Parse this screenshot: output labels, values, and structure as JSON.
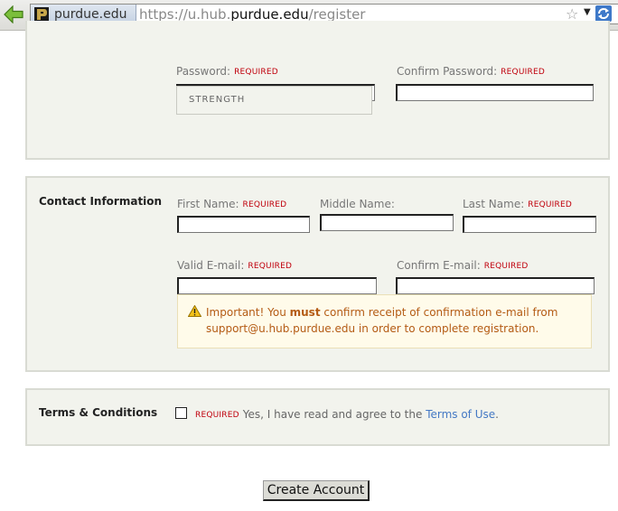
{
  "browser": {
    "identity_label": "purdue.edu",
    "url_prefix": "https://u.hub.",
    "url_domain": "purdue.edu",
    "url_path": "/register"
  },
  "password_section": {
    "password_label": "Password:",
    "confirm_password_label": "Confirm Password:",
    "required_tag": "REQUIRED",
    "strength_label": "STRENGTH"
  },
  "contact_section": {
    "title": "Contact Information",
    "first_name_label": "First Name:",
    "middle_name_label": "Middle Name:",
    "last_name_label": "Last Name:",
    "email_label": "Valid E-mail:",
    "confirm_email_label": "Confirm E-mail:",
    "required_tag": "REQUIRED",
    "warning_prefix": "Important! You ",
    "warning_emphasis": "must",
    "warning_line1_suffix": " confirm receipt of confirmation e-mail from",
    "warning_line2": "support@u.hub.purdue.edu in order to complete registration."
  },
  "terms_section": {
    "title": "Terms & Conditions",
    "required_tag": "REQUIRED",
    "agree_text": "Yes, I have read and agree to the ",
    "link_text": "Terms of Use",
    "suffix": "."
  },
  "actions": {
    "create_label": "Create Account"
  },
  "colors": {
    "section_bg": "#f2f3ed",
    "required": "#c0000c",
    "warning_text": "#b45b14",
    "link": "#4478c4"
  }
}
